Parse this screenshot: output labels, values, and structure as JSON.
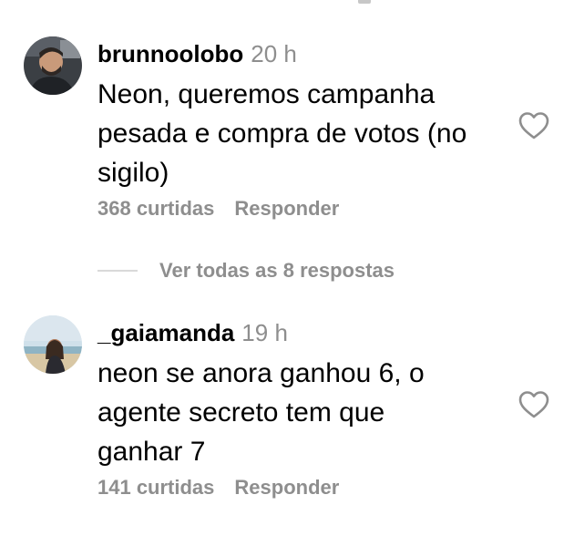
{
  "comments": [
    {
      "username": "brunnoolobo",
      "timestamp": "20 h",
      "text_lines": [
        "Neon, queremos campanha",
        "pesada e compra de votos (no",
        "sigilo)"
      ],
      "likes": "368 curtidas",
      "reply": "Responder"
    },
    {
      "username": "_gaiamanda",
      "timestamp": "19 h",
      "text_lines": [
        "neon se anora ganhou 6, o",
        "agente secreto tem que",
        "ganhar 7"
      ],
      "likes": "141 curtidas",
      "reply": "Responder"
    }
  ],
  "view_replies": "Ver todas as 8 respostas",
  "icons": {
    "like": "heart-outline-icon",
    "avatar": "avatar"
  },
  "colors": {
    "text": "#000000",
    "secondary": "#8e8e8e",
    "divider": "#d9d9d9"
  }
}
